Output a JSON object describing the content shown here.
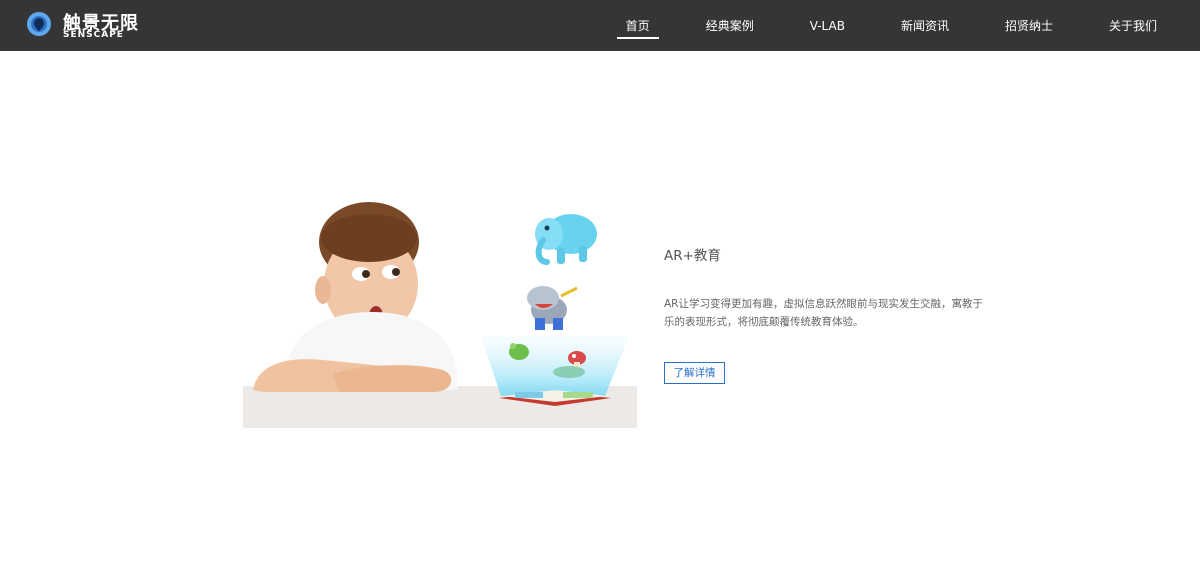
{
  "header": {
    "logo_cn": "触景无限",
    "logo_en": "SENSCAPE",
    "nav": [
      {
        "label": "首页",
        "active": true
      },
      {
        "label": "经典案例",
        "active": false
      },
      {
        "label": "V-LAB",
        "active": false
      },
      {
        "label": "新闻资讯",
        "active": false
      },
      {
        "label": "招贤纳士",
        "active": false
      },
      {
        "label": "关于我们",
        "active": false
      }
    ]
  },
  "feature": {
    "image_name": "ar-education-boy-book-illustration",
    "title": "AR+教育",
    "description": "AR让学习变得更加有趣，虚拟信息跃然眼前与现实发生交融，寓教于乐的表现形式，将彻底颠覆传统教育体验。",
    "button_label": "了解详情"
  },
  "colors": {
    "header_bg": "#353535",
    "accent": "#2a6fc9",
    "text": "#555555"
  }
}
